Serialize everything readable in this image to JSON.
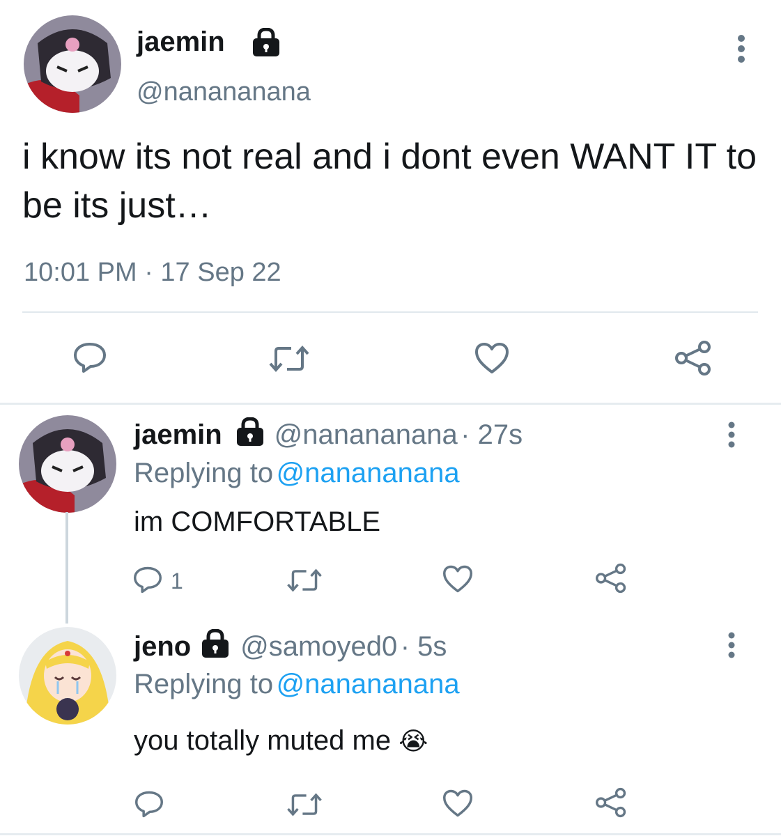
{
  "tweet": {
    "name": "jaemin",
    "handle": "@nanananana",
    "text": "i know its not real and i dont even WANT IT to be its just…",
    "timestamp": "10:01 PM · 17 Sep 22",
    "avatar_icon": "kuromi-avatar"
  },
  "replies": [
    {
      "name": "jaemin",
      "handle": "@nanananana",
      "time": "· 27s",
      "replying_label": "Replying to",
      "replying_handle": "@nanananana",
      "text": "im COMFORTABLE",
      "reply_count": "1",
      "avatar_icon": "kuromi-avatar"
    },
    {
      "name": "jeno",
      "handle": "@samoyed0",
      "time": "· 5s",
      "replying_label": "Replying to",
      "replying_handle": "@nanananana",
      "text": "you totally muted me",
      "emoji": "😭",
      "avatar_icon": "sailor-moon-avatar"
    }
  ],
  "colors": {
    "accent": "#1da1f2",
    "secondary_text": "#657786",
    "icon": "#657786"
  }
}
